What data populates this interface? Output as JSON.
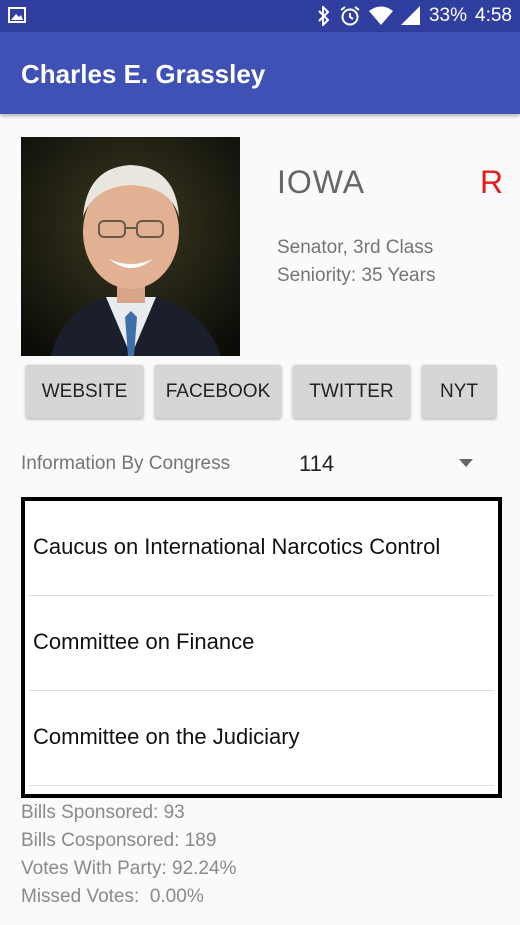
{
  "status_bar": {
    "battery": "33%",
    "time": "4:58",
    "icons": [
      "image-icon",
      "bluetooth-icon",
      "alarm-icon",
      "wifi-icon",
      "signal-icon",
      "battery-icon"
    ]
  },
  "app_bar": {
    "title": "Charles E. Grassley"
  },
  "profile": {
    "state": "IOWA",
    "party": "R",
    "rank": "Senator, 3rd Class",
    "seniority": "Seniority: 35 Years",
    "party_color": "#e41c1c"
  },
  "buttons": {
    "website": "WEBSITE",
    "facebook": "FACEBOOK",
    "twitter": "TWITTER",
    "nyt": "NYT"
  },
  "congress": {
    "label": "Information By Congress",
    "selected": "114"
  },
  "committees": [
    {
      "name": "Caucus on International Narcotics Control"
    },
    {
      "name": "Committee on Finance"
    },
    {
      "name": "Committee on the Judiciary"
    }
  ],
  "stats": {
    "bills_sponsored": "Bills Sponsored: 93",
    "bills_cosponsored": "Bills Cosponsored: 189",
    "votes_with_party": "Votes With Party: 92.24%",
    "missed_votes": "Missed Votes:  0.00%"
  },
  "colors": {
    "status_bar": "#303f9f",
    "app_bar": "#3f51b5"
  }
}
